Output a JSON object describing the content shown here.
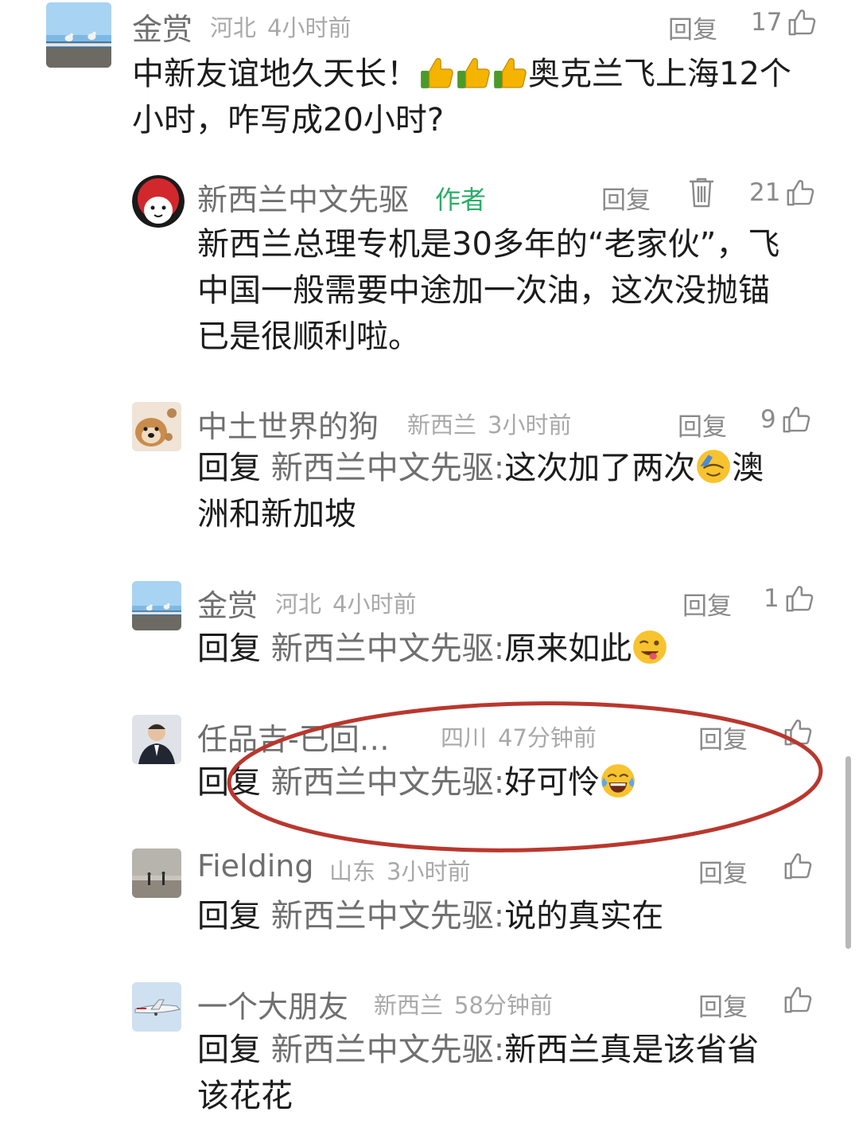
{
  "reply_label": "回复",
  "comments": [
    {
      "name": "金赏",
      "location": "河北",
      "time": "4小时前",
      "likes": "17",
      "text_a": "中新友谊地久天长！",
      "text_b": "奥克兰飞上海12个",
      "text_c": "小时，咋写成20小时?"
    },
    {
      "name": "新西兰中文先驱",
      "author_tag": "作者",
      "likes": "21",
      "line1": "新西兰总理专机是30多年的“老家伙”，飞",
      "line2": "中国一般需要中途加一次油，这次没抛锚",
      "line3": "已是很顺利啦。"
    },
    {
      "name": "中土世界的狗",
      "location": "新西兰",
      "time": "3小时前",
      "likes": "9",
      "reply_prefix": "回复",
      "reply_target": "新西兰中文先驱:",
      "text_a": "这次加了两次",
      "text_b": "澳",
      "text_c": "洲和新加坡"
    },
    {
      "name": "金赏",
      "location": "河北",
      "time": "4小时前",
      "likes": "1",
      "reply_prefix": "回复",
      "reply_target": "新西兰中文先驱:",
      "text_a": "原来如此"
    },
    {
      "name": "任品吉-已回…",
      "location": "四川",
      "time": "47分钟前",
      "reply_prefix": "回复",
      "reply_target": "新西兰中文先驱:",
      "text_a": "好可怜"
    },
    {
      "name": "Fielding",
      "location": "山东",
      "time": "3小时前",
      "reply_prefix": "回复",
      "reply_target": "新西兰中文先驱:",
      "text_a": "说的真实在"
    },
    {
      "name": "一个大朋友",
      "location": "新西兰",
      "time": "58分钟前",
      "reply_prefix": "回复",
      "reply_target": "新西兰中文先驱:",
      "text_a": "新西兰真是该省省",
      "text_b": "该花花"
    }
  ],
  "colors": {
    "name_gray": "#6f6f6f",
    "meta_gray": "#a9a9a9",
    "author_green": "#2aae67",
    "annotation_red": "#b9372e"
  },
  "icons": [
    "thumbs-up-icon",
    "trash-icon",
    "thumbs-up-emoji",
    "facepalm-emoji",
    "wink-tongue-emoji",
    "tears-of-joy-emoji"
  ]
}
